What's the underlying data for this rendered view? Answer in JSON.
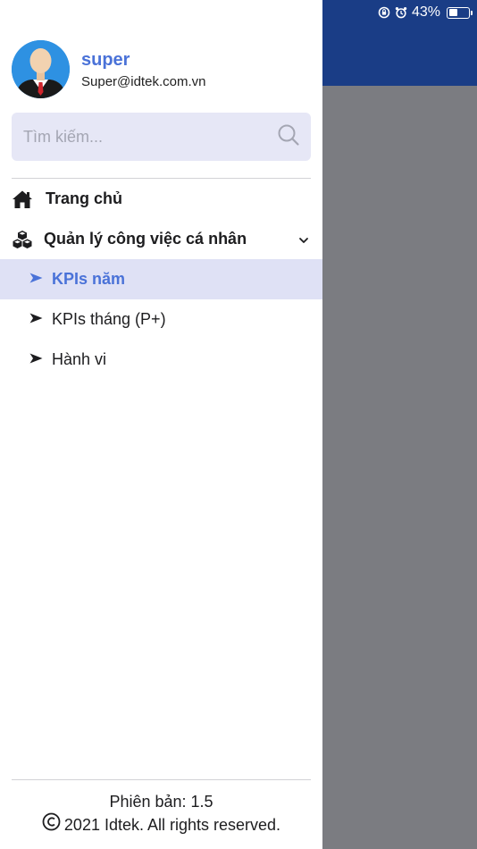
{
  "status_bar": {
    "battery_percent": "43%",
    "battery_level": 0.43
  },
  "profile": {
    "username": "super",
    "email": "Super@idtek.com.vn"
  },
  "search": {
    "placeholder": "Tìm kiếm...",
    "value": ""
  },
  "menu": {
    "home_label": "Trang chủ",
    "personal_work_label": "Quản lý công việc cá nhân",
    "sub_items": [
      {
        "label": "KPIs năm",
        "active": true
      },
      {
        "label": "KPIs tháng (P+)",
        "active": false
      },
      {
        "label": "Hành vi",
        "active": false
      }
    ]
  },
  "footer": {
    "version": "Phiên bản: 1.5",
    "copyright": "2021 Idtek. All rights reserved."
  },
  "colors": {
    "accent": "#4a72d8",
    "header": "#1a3d86",
    "overlay": "#7b7c81",
    "search_bg": "#e6e7f6",
    "active_bg": "#dfe1f5"
  }
}
